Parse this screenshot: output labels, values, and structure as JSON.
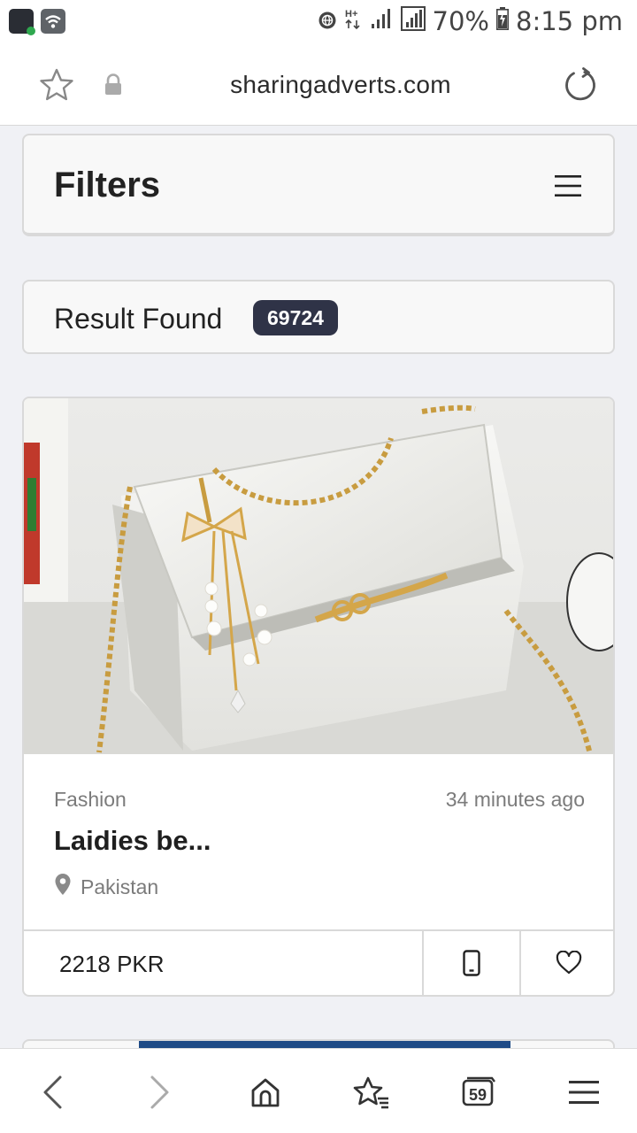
{
  "status_bar": {
    "battery": "70%",
    "time": "8:15 pm",
    "icons": [
      "app-icon",
      "wifi-icon",
      "vpn-globe-icon",
      "data-hplus-icon",
      "signal-icon",
      "signal-icon",
      "battery-icon"
    ]
  },
  "browser": {
    "url": "sharingadverts.com",
    "icons": [
      "bookmark-star-icon",
      "lock-icon",
      "reload-icon"
    ]
  },
  "filters": {
    "title": "Filters",
    "icon": "menu-icon"
  },
  "results": {
    "label": "Result Found",
    "count": "69724"
  },
  "listing": {
    "category": "Fashion",
    "time_ago": "34 minutes ago",
    "title": "Laidies be...",
    "location": "Pakistan",
    "price": "2218 PKR",
    "icons": [
      "map-pin-icon",
      "phone-icon",
      "heart-icon"
    ]
  },
  "bottom_nav": {
    "tabs_count": "59",
    "icons": [
      "back-icon",
      "forward-icon",
      "home-icon",
      "bookmarks-icon",
      "tabs-icon",
      "menu-icon"
    ]
  },
  "colors": {
    "page_bg": "#f0f1f5",
    "badge_bg": "#2f3347",
    "text_dark": "#1f1f1f",
    "text_muted": "#7b7b7b",
    "border": "#d9d9d9"
  }
}
